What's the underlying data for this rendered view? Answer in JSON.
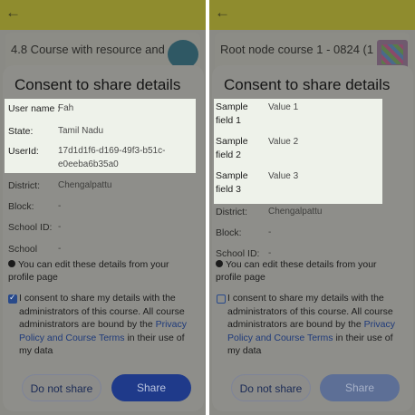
{
  "left": {
    "back_icon": "arrow-left-icon",
    "course_title": "4.8 Course with resource and",
    "dialog_title": "Consent to share details",
    "fields": [
      {
        "label": "User name :",
        "value": "Fah"
      },
      {
        "label": "State:",
        "value": "Tamil Nadu"
      },
      {
        "label": "UserId:",
        "value": "17d1d1f6-d169-49f3-b51c-",
        "value2": "e0eeba6b35a0"
      },
      {
        "label": "District:",
        "value": "Chengalpattu"
      },
      {
        "label": "Block:",
        "value": "-"
      },
      {
        "label": "School ID:",
        "value": "-"
      },
      {
        "label": "School",
        "value": "-"
      }
    ],
    "info_text": "You can edit these details from your profile page",
    "consent_checked": true,
    "consent_prefix": "I consent to share my details with the administrators of this course. All course administrators are bound by the ",
    "consent_link": "Privacy Policy and Course Terms",
    "consent_suffix": " in their use of my data",
    "btn_secondary": "Do not share",
    "btn_primary": "Share"
  },
  "right": {
    "back_icon": "arrow-left-icon",
    "course_title": "Root node course 1 - 0824 (1",
    "dialog_title": "Consent to share details",
    "fields": [
      {
        "label": "Sample",
        "label2": "field 1",
        "value": "Value 1"
      },
      {
        "label": "Sample",
        "label2": "field 2",
        "value": "Value 2"
      },
      {
        "label": "Sample",
        "label2": "field 3",
        "value": "Value 3"
      },
      {
        "label": "District:",
        "value": "Chengalpattu"
      },
      {
        "label": "Block:",
        "value": "-"
      },
      {
        "label": "School ID:",
        "value": "-"
      }
    ],
    "info_text": "You can edit these details from your profile page",
    "consent_checked": false,
    "consent_prefix": "I consent to share my details with the administrators of this course. All course administrators are bound by the ",
    "consent_link": "Privacy Policy and Course Terms",
    "consent_suffix": " in their use of my data",
    "btn_secondary": "Do not share",
    "btn_primary": "Share"
  },
  "colors": {
    "topbar": "#8f8c2e",
    "scrim": "#8a8a85",
    "highlight": "#eef2ea",
    "primary": "#1f3a8a",
    "link": "#1e3a7a"
  }
}
